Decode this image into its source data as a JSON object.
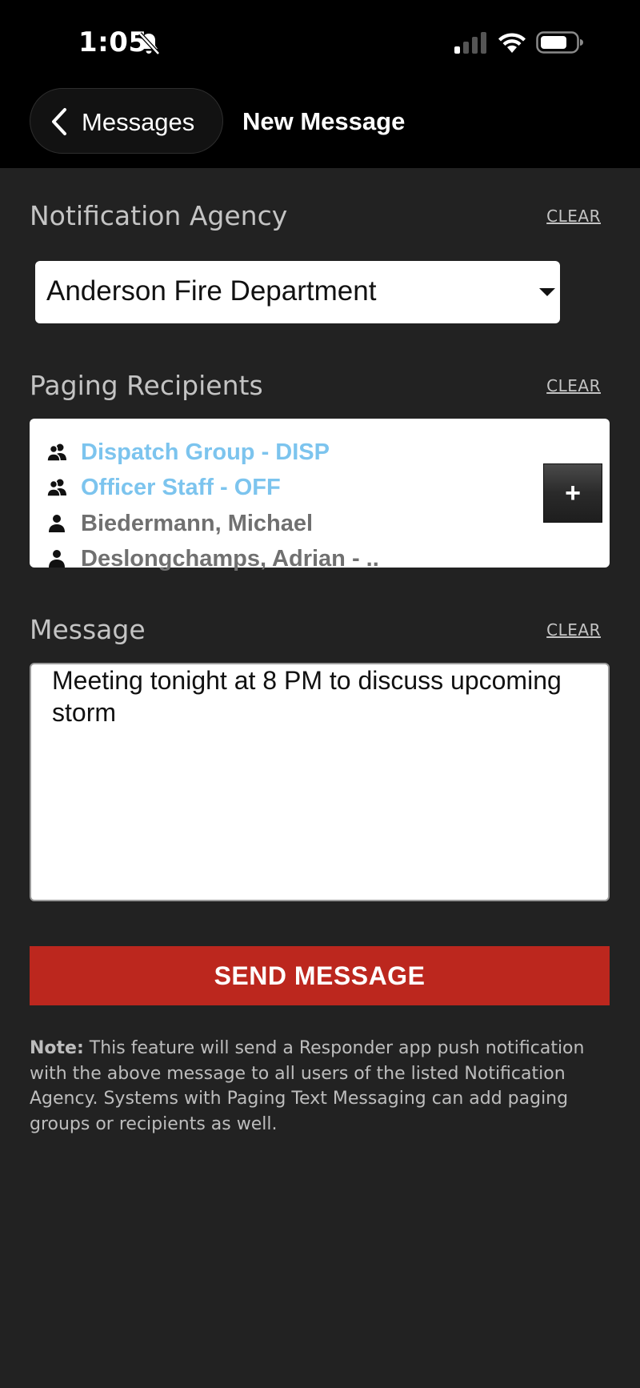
{
  "status_bar": {
    "time": "1:05",
    "icons": [
      "bell-slash-icon",
      "signal-icon",
      "wifi-icon",
      "battery-icon"
    ]
  },
  "nav": {
    "back_label": "Messages",
    "title": "New Message"
  },
  "notification_agency": {
    "label": "Notification Agency",
    "clear_label": "CLEAR",
    "selected_value": "Anderson Fire Department"
  },
  "paging_recipients": {
    "label": "Paging Recipients",
    "clear_label": "CLEAR",
    "add_label": "+",
    "items": [
      {
        "name": "Dispatch Group - DISP",
        "type": "group",
        "icon": "group-icon"
      },
      {
        "name": "Officer Staff - OFF",
        "type": "group",
        "icon": "group-icon"
      },
      {
        "name": "Biedermann, Michael",
        "type": "person",
        "icon": "person-icon"
      },
      {
        "name": "Deslongchamps, Adrian -  ..",
        "type": "person",
        "icon": "person-icon"
      }
    ]
  },
  "message": {
    "label": "Message",
    "clear_label": "CLEAR",
    "value": "Meeting tonight at 8 PM to discuss upcoming storm"
  },
  "send_button_label": "SEND MESSAGE",
  "note": {
    "prefix": "Note:",
    "text": "This feature will send a Responder app push notification with the above message to all users of the listed Notification Agency. Systems with Paging Text Messaging can add paging groups or recipients as well."
  },
  "colors": {
    "background": "#222222",
    "header": "#000000",
    "accent_red": "#bc271e",
    "group_blue": "#7cc4ee",
    "person_gray": "#707070"
  }
}
